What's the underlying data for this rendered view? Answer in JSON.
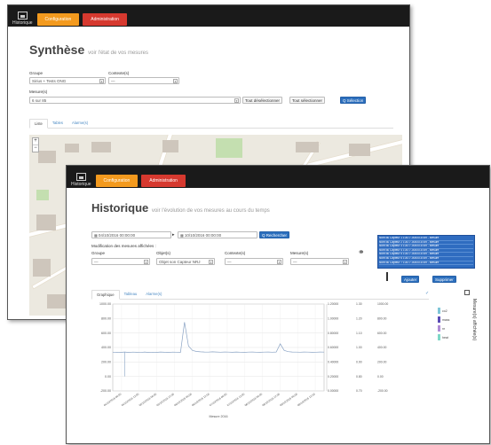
{
  "colors": {
    "nav_orange": "#f39a1e",
    "nav_red": "#d6392f",
    "topbar": "#1a1a1a",
    "primary_blue": "#2c6fbd",
    "series_dark": "#8aa3c4",
    "series_teal": "#7fc6d8",
    "series_purple": "#b08dd6"
  },
  "back_window": {
    "logo_label": "Historique",
    "nav": [
      "Configuration",
      "Administration"
    ],
    "title": "Synthèse",
    "subtitle": "voir l'état de vos mesures",
    "groupe_label": "Groupe",
    "groupe_value": "Sirius + Tests ONG",
    "contexte_label": "Contexte(s)",
    "contexte_value": "—",
    "mesure_label": "Mesure(s)",
    "mesure_value": "6 sur 85",
    "btn_deselect": "Tout désélectionner",
    "btn_select": "Tout sélectionner",
    "btn_submit": "Q Sélection",
    "tabs": [
      "Liste",
      "Tables",
      "Alarme(s)"
    ],
    "zoom_in": "+",
    "zoom_out": "−"
  },
  "front_window": {
    "logo_label": "Historique",
    "nav": [
      "Configuration",
      "Administration"
    ],
    "title": "Historique",
    "subtitle": "voir l'évolution de vos mesures au cours du temps",
    "date_from": "04/10/2016 00:00:00",
    "date_to": "10/10/2016 00:00:00",
    "btn_search": "Q Rechercher",
    "filter_title": "Modification des mesures affichées :",
    "groupe_label": "Groupe",
    "groupe_value": "—",
    "objet_label": "Objet(s)",
    "objet_value": "Objet son Capteur NRJ",
    "contexte_label": "Contexte(s)",
    "contexte_value": "—",
    "mesure_label": "Mesure(s)",
    "mesure_value": "—",
    "list_items": [
      "Nom du Capteur 1 10477-00000-6789 - Mesure",
      "Nom du Capteur 2 10477-00000-6789 - Mesure",
      "Nom du Capteur 3 10477-00000-6789 - Mesure",
      "Nom du Capteur 4 10477-00000-6789 - Mesure",
      "Nom du Capteur 5 10477-00000-6789 - Mesure",
      "Nom du Capteur 6 10477-00000-6789 - Mesure",
      "Nom du Capteur 7 10477-00000-6789 - Mesure"
    ],
    "btn_ajouter": "Ajouter",
    "btn_supprimer": "Supprimer",
    "tabs": [
      "Graphique",
      "Tableau",
      "Alarme(s)"
    ],
    "vertical_title": "Mesure(s) affichée(s)",
    "legend": [
      "co2",
      "mass",
      "nr",
      "heat"
    ],
    "chart_xlabel": "Mesure 2016"
  },
  "chart_data": {
    "type": "line",
    "series": [
      {
        "values": [
          330,
          335,
          333,
          338,
          332,
          336,
          334,
          330,
          337,
          331,
          335,
          333,
          338,
          334,
          332,
          336,
          335,
          333,
          750,
          420,
          360,
          345,
          340,
          338,
          336,
          340,
          337,
          335,
          338,
          336,
          334,
          337,
          335,
          333,
          336,
          338,
          335,
          334,
          336,
          338,
          335,
          337,
          450,
          360,
          342,
          338,
          336,
          335,
          337,
          336,
          334,
          335,
          337,
          336
        ]
      }
    ],
    "dips": [
      {
        "index": 3,
        "value": 0
      }
    ],
    "ylim": [
      -200,
      1000
    ],
    "y_ticks_left": [
      "1000.00",
      "800.00",
      "600.00",
      "400.00",
      "200.00",
      "0.00",
      "-200.00"
    ],
    "y_ticks_r1": [
      "1.20000",
      "1.00000",
      "0.80000",
      "0.60000",
      "0.40000",
      "0.20000",
      "0.00000"
    ],
    "y_ticks_r2": [
      "1.30",
      "1.20",
      "1.10",
      "1.00",
      "0.90",
      "0.80",
      "0.70"
    ],
    "y_ticks_r3": [
      "1000.00",
      "800.00",
      "600.00",
      "400.00",
      "200.00",
      "0.00",
      "-200.00"
    ],
    "x_ticks": [
      "04/10/2016 00:00",
      "04/10/2016 12:00",
      "05/10/2016 00:00",
      "05/10/2016 12:00",
      "06/10/2016 00:00",
      "06/10/2016 12:00",
      "07/10/2016 00:00",
      "07/10/2016 12:00",
      "08/10/2016 00:00",
      "08/10/2016 12:00",
      "09/10/2016 00:00",
      "09/10/2016 12:00"
    ],
    "grid": true
  }
}
